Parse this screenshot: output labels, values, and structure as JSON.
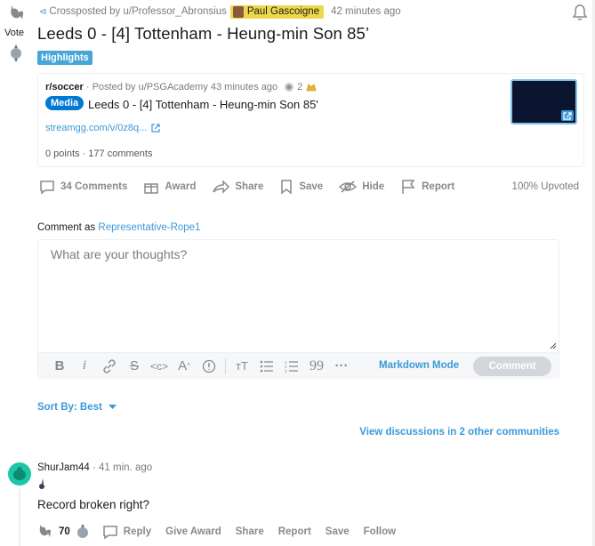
{
  "post": {
    "vote_label": "Vote",
    "crosspost_prefix": "Crossposted by",
    "crosspost_user": "u/Professor_Abronsius",
    "flair": "Paul Gascoigne",
    "time": "42 minutes ago",
    "title": "Leeds 0 - [4] Tottenham - Heung-min Son 85’",
    "tag": "Highlights",
    "icons": [
      "rooster-upvote-icon",
      "rooster-downvote-icon",
      "bell-icon"
    ]
  },
  "crosspost_card": {
    "subreddit": "r/soccer",
    "posted_by": "· Posted by u/PSGAcademy 43 minutes ago",
    "award_count": "2",
    "media_tag": "Media",
    "title": "Leeds 0 - [4] Tottenham - Heung-min Son 85'",
    "link": "streamgg.com/v/0z8q...",
    "stats": "0 points · 177 comments",
    "thumb_color": "#0b1530"
  },
  "actions": {
    "comments": "34 Comments",
    "award": "Award",
    "share": "Share",
    "save": "Save",
    "hide": "Hide",
    "report": "Report",
    "upvoted": "100% Upvoted"
  },
  "comment_form": {
    "comment_as_prefix": "Comment as",
    "username": "Representative-Rope1",
    "placeholder": "What are your thoughts?",
    "markdown_mode": "Markdown Mode",
    "submit": "Comment",
    "toolbar": [
      "bold-icon",
      "italic-icon",
      "link-icon",
      "strikethrough-icon",
      "inline-code-icon",
      "superscript-icon",
      "spoiler-icon",
      "heading-icon",
      "bulleted-list-icon",
      "numbered-list-icon",
      "quote-icon",
      "more-icon"
    ]
  },
  "sort": {
    "label": "Sort By: Best"
  },
  "view_discussions": "View discussions in 2 other communities",
  "comment": {
    "author": "ShurJam44",
    "time": "· 41 min. ago",
    "body": "Record broken right?",
    "score": "70",
    "reply": "Reply",
    "give_award": "Give Award",
    "share": "Share",
    "report": "Report",
    "save": "Save",
    "follow": "Follow"
  },
  "colors": {
    "accent_blue": "#3a9ad9",
    "media_blue": "#0079d3",
    "flair_yellow": "#edd74a",
    "avatar_teal": "#1dc7a6"
  }
}
